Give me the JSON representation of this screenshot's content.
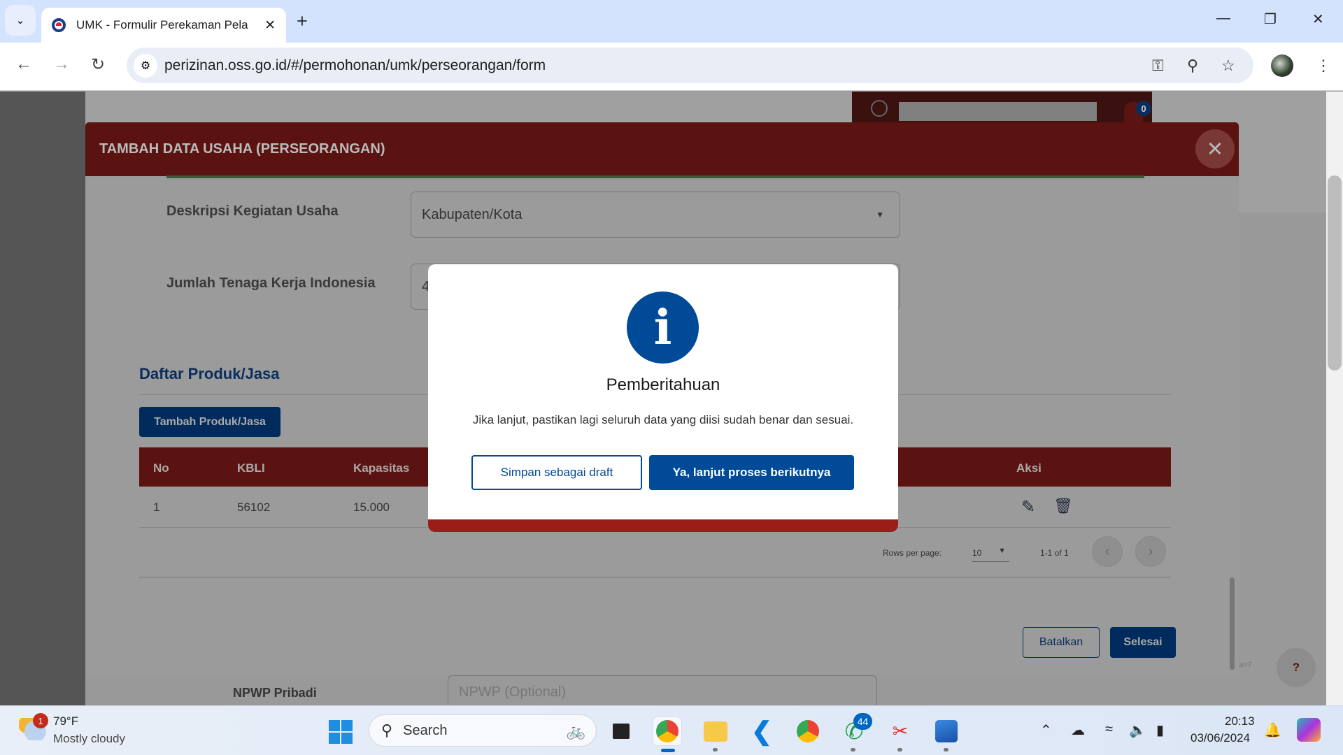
{
  "browser": {
    "tab_title": "UMK - Formulir Perekaman Pela",
    "url": "perizinan.oss.go.id/#/permohonan/umk/perseorangan/form"
  },
  "header": {
    "notification_count": "0"
  },
  "modal": {
    "title": "TAMBAH DATA USAHA (PERSEORANGAN)",
    "fields": [
      {
        "label": "Deskripsi Kegiatan Usaha",
        "value": "Kabupaten/Kota"
      },
      {
        "label": "Jumlah Tenaga Kerja Indonesia",
        "value": "4"
      }
    ],
    "section_title": "Daftar Produk/Jasa",
    "add_button": "Tambah Produk/Jasa",
    "table": {
      "columns": [
        "No",
        "KBLI",
        "Kapasitas",
        "Aksi"
      ],
      "rows": [
        {
          "no": "1",
          "kbli": "56102",
          "kapasitas": "15.000"
        }
      ]
    },
    "pagination": {
      "rows_per_page_label": "Rows per page:",
      "rows_per_page": "10",
      "range": "1-1 of 1"
    },
    "cancel_button": "Batalkan",
    "finish_button": "Selesai"
  },
  "background_form": {
    "npwp_label": "NPWP Pribadi",
    "npwp_placeholder": "NPWP (Optional)",
    "help_hint": "an?"
  },
  "dialog": {
    "icon": "info-icon",
    "title": "Pemberitahuan",
    "message": "Jika lanjut, pastikan lagi seluruh data yang diisi sudah benar dan sesuai.",
    "draft_button": "Simpan sebagai draft",
    "next_button": "Ya, lanjut proses berikutnya"
  },
  "taskbar": {
    "weather_badge": "1",
    "temperature": "79°F",
    "condition": "Mostly cloudy",
    "search_placeholder": "Search",
    "whatsapp_badge": "44",
    "time": "20:13",
    "date": "03/06/2024"
  },
  "colors": {
    "brand_red": "#9a1e17",
    "primary_blue": "#004a98",
    "dark_blue": "#002b5c"
  }
}
